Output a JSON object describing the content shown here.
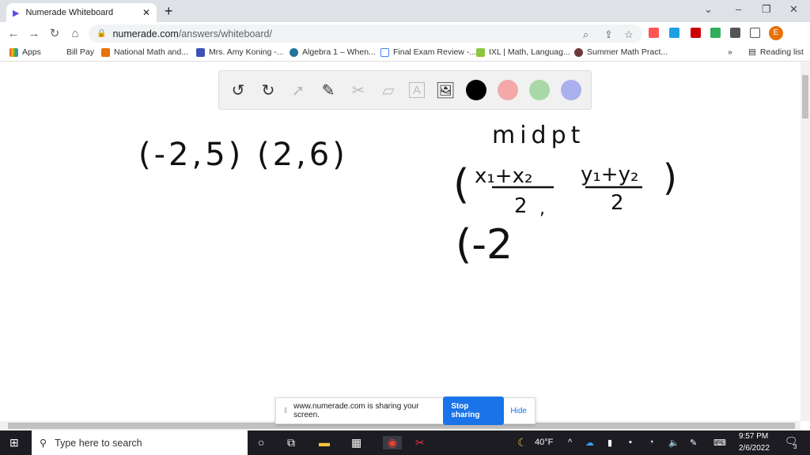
{
  "browser": {
    "tab_title": "Numerade Whiteboard",
    "url_domain": "numerade.com",
    "url_path": "/answers/whiteboard/",
    "avatar_letter": "E"
  },
  "bookmarks": [
    "Apps",
    "Bill Pay",
    "National Math and...",
    "Mrs. Amy Koning -...",
    "Algebra 1 – When...",
    "Final Exam Review -...",
    "IXL | Math, Languag...",
    "Summer Math Pract..."
  ],
  "reading_list": "Reading list",
  "toolbar": {
    "tools": [
      "undo",
      "redo",
      "select",
      "pen",
      "tools",
      "eraser",
      "text",
      "image"
    ],
    "colors": [
      "#000000",
      "#f4a8a8",
      "#a8d8a8",
      "#aab0ee"
    ]
  },
  "whiteboard": {
    "points": "(-2,5) (2,6)",
    "heading": "midpt",
    "formula_x_num": "x₁+x₂",
    "formula_x_den": "2",
    "formula_y_num": "y₁+y₂",
    "formula_y_den": "2",
    "work": "(-2"
  },
  "share_bar": {
    "message": "www.numerade.com is sharing your screen.",
    "stop_label": "Stop sharing",
    "hide_label": "Hide"
  },
  "taskbar": {
    "search_placeholder": "Type here to search",
    "weather": "40°F",
    "time": "9:57 PM",
    "date": "2/6/2022",
    "notifications": "3"
  }
}
